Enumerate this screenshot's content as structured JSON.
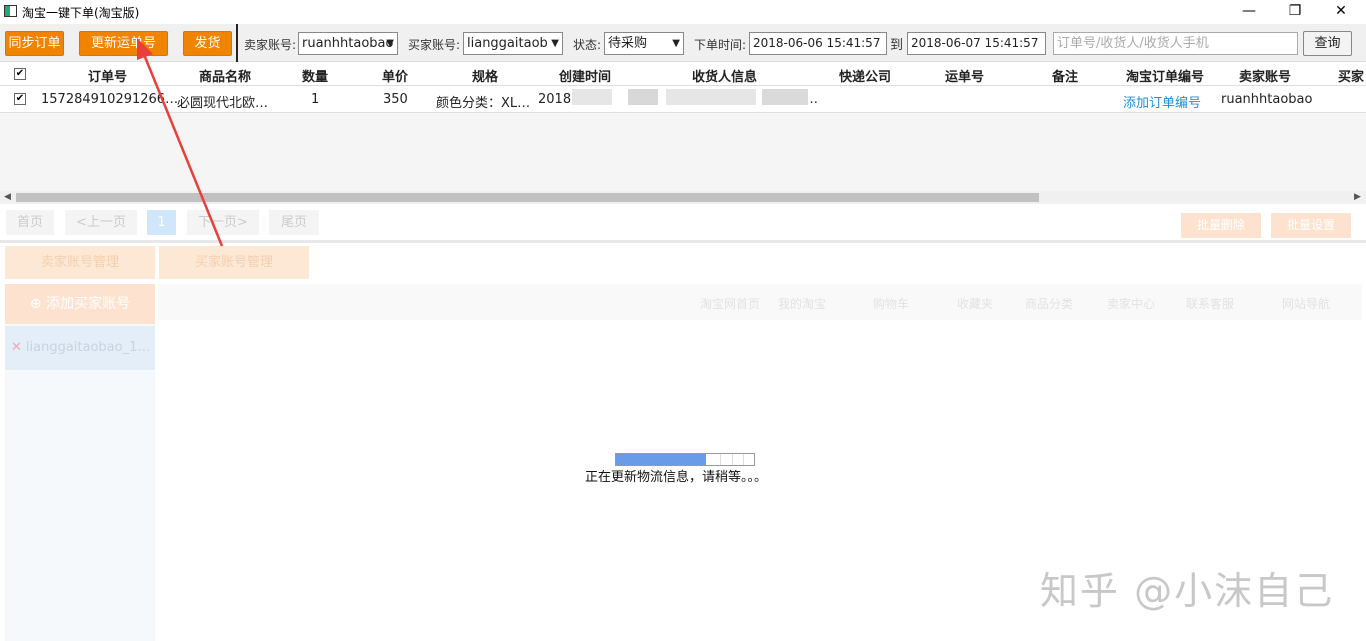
{
  "window": {
    "title": "淘宝一键下单(淘宝版)",
    "minimize_glyph": "—",
    "restore_glyph": "❐",
    "close_glyph": "✕"
  },
  "toolbar": {
    "sync_orders": "同步订单",
    "update_tracking": "更新运单号",
    "ship": "发货",
    "seller_account_label": "卖家账号:",
    "seller_account_value": "ruanhhtaobao",
    "buyer_account_label": "买家账号:",
    "buyer_account_value": "lianggaitaob",
    "status_label": "状态:",
    "status_value": "待采购",
    "order_time_label": "下单时间:",
    "order_time_from": "2018-06-06 15:41:57",
    "to_label": "到",
    "order_time_to": "2018-06-07 15:41:57",
    "search_placeholder": "订单号/收货人/收货人手机",
    "query": "查询"
  },
  "table": {
    "columns": [
      "订单号",
      "商品名称",
      "数量",
      "单价",
      "规格",
      "创建时间",
      "收货人信息",
      "快递公司",
      "运单号",
      "备注",
      "淘宝订单编号",
      "卖家账号",
      "买家"
    ],
    "rows": [
      {
        "order_no": "157284910291266…",
        "product": "必圆现代北欧…",
        "qty": "1",
        "price": "350",
        "spec": "颜色分类：XL…",
        "created": "2018",
        "receiver": "…",
        "taobao_order_action": "添加订单编号",
        "seller": "ruanhhtaobao"
      }
    ]
  },
  "pager": {
    "first": "首页",
    "prev": "<上一页",
    "current": "1",
    "next": "下一页>",
    "last": "尾页",
    "batch_delete": "批量删除",
    "batch_settings": "批量设置"
  },
  "tabs": {
    "seller_mgmt": "卖家账号管理",
    "buyer_mgmt": "买家账号管理"
  },
  "left_panel": {
    "add_buyer": "添加买家账号",
    "buyer_item": "lianggaitaobao_1…",
    "remove_glyph": "✕"
  },
  "web_nav": [
    "淘宝网首页",
    "我的淘宝",
    "购物车",
    "收藏夹",
    "商品分类",
    "卖家中心",
    "联系客服",
    "网站导航"
  ],
  "progress": {
    "fraction": 0.65,
    "message": "正在更新物流信息，请稍等。。。"
  },
  "watermark": "知乎 @小沫自己",
  "colors": {
    "accent_orange": "#f08300",
    "link_blue": "#1f8fd6",
    "progress_blue": "#6a9be6",
    "annotation_red": "#e8413b"
  }
}
